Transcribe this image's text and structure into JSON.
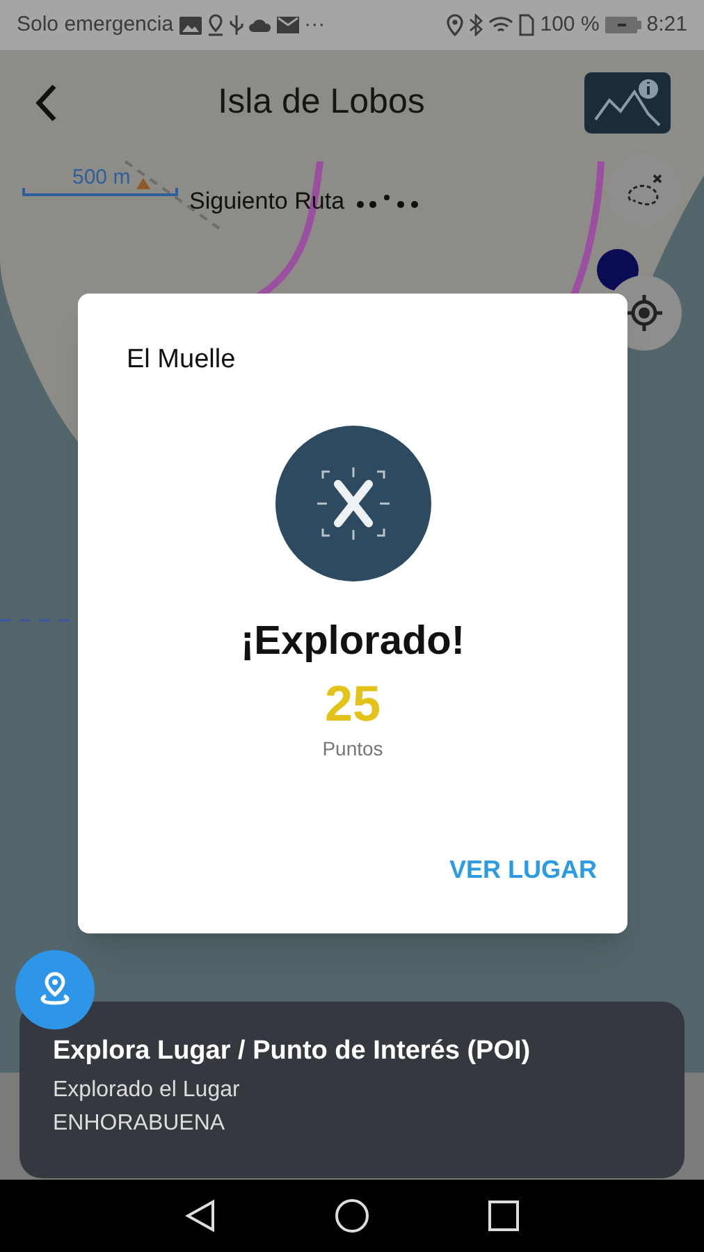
{
  "status_bar": {
    "carrier": "Solo emergencia",
    "more": "···",
    "battery_percent": "100 %",
    "time": "8:21"
  },
  "header": {
    "title": "Isla de Lobos"
  },
  "map": {
    "scale": "500 m",
    "route_label": "Siguiento Ruta"
  },
  "dialog": {
    "place": "El Muelle",
    "title": "¡Explorado!",
    "points": "25",
    "points_label": "Puntos",
    "action": "VER LUGAR"
  },
  "toast": {
    "title": "Explora Lugar / Punto de Interés (POI)",
    "lines": [
      "Explorado el Lugar",
      "ENHORABUENA"
    ]
  }
}
